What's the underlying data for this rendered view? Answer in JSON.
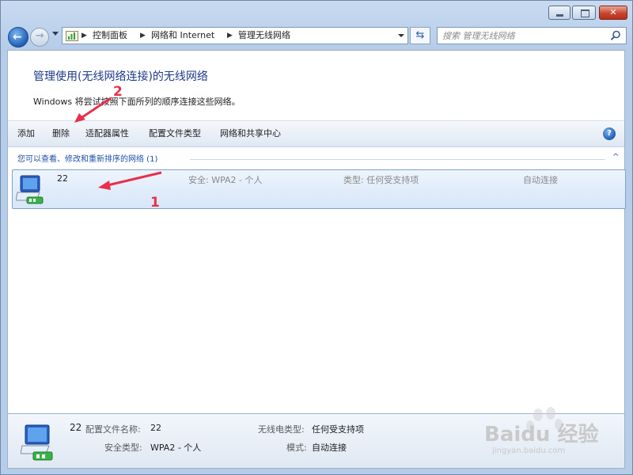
{
  "address": {
    "crumbs": [
      "控制面板",
      "网络和 Internet",
      "管理无线网络"
    ]
  },
  "search": {
    "placeholder": "搜索 管理无线网络"
  },
  "page": {
    "title": "管理使用(无线网络连接)的无线网络",
    "description": "Windows 将尝试按照下面所列的顺序连接这些网络。"
  },
  "toolbar": {
    "add": "添加",
    "delete": "删除",
    "adapter": "适配器属性",
    "profile_types": "配置文件类型",
    "sharing_center": "网络和共享中心",
    "help": "?"
  },
  "group": {
    "header": "您可以查看、修改和重新排序的网络 (1)",
    "chevron": "^"
  },
  "networks": [
    {
      "name": "22",
      "security": "安全: WPA2 - 个人",
      "type": "类型: 任何受支持项",
      "mode": "自动连接"
    }
  ],
  "annotations": {
    "one": "1",
    "two": "2"
  },
  "details": {
    "name": "22",
    "profile_label": "配置文件名称:",
    "profile_value": "22",
    "security_label": "安全类型:",
    "security_value": "WPA2 - 个人",
    "radio_label": "无线电类型:",
    "radio_value": "任何受支持项",
    "mode_label": "模式:",
    "mode_value": "自动连接"
  },
  "watermark": {
    "brand": "Baidu 经验",
    "url": "jingyan.baidu.com"
  },
  "colors": {
    "title": "#1e3a8a",
    "selection": "#d7e6f9",
    "annotation": "#e8304a",
    "link": "#1e4fa8"
  }
}
